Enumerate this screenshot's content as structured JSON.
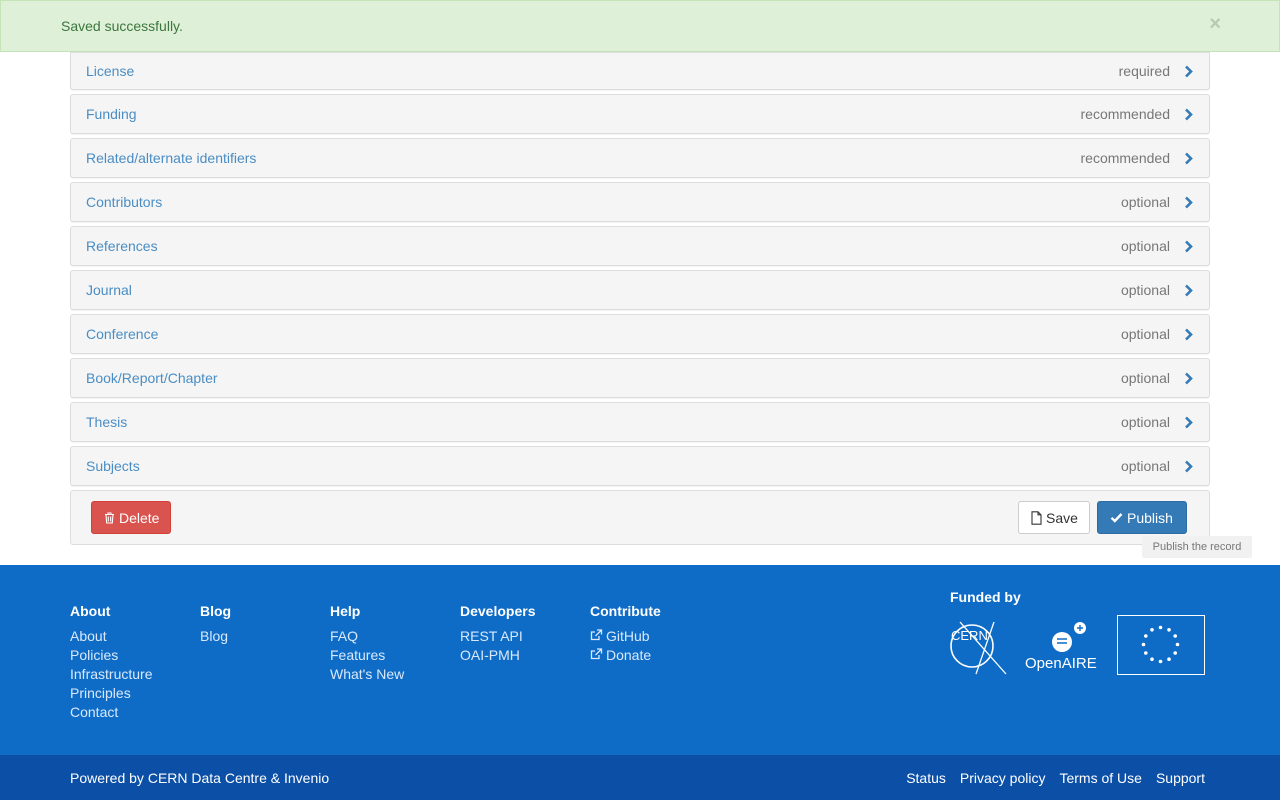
{
  "alert": {
    "message": "Saved successfully.",
    "close": "×"
  },
  "panels": [
    {
      "title": "License",
      "status": "required"
    },
    {
      "title": "Funding",
      "status": "recommended"
    },
    {
      "title": "Related/alternate identifiers",
      "status": "recommended"
    },
    {
      "title": "Contributors",
      "status": "optional"
    },
    {
      "title": "References",
      "status": "optional"
    },
    {
      "title": "Journal",
      "status": "optional"
    },
    {
      "title": "Conference",
      "status": "optional"
    },
    {
      "title": "Book/Report/Chapter",
      "status": "optional"
    },
    {
      "title": "Thesis",
      "status": "optional"
    },
    {
      "title": "Subjects",
      "status": "optional"
    }
  ],
  "actions": {
    "delete": "Delete",
    "save": "Save",
    "publish": "Publish",
    "publish_tooltip": "Publish the record"
  },
  "footer": {
    "columns": [
      {
        "heading": "About",
        "links": [
          "About",
          "Policies",
          "Infrastructure",
          "Principles",
          "Contact"
        ]
      },
      {
        "heading": "Blog",
        "links": [
          "Blog"
        ]
      },
      {
        "heading": "Help",
        "links": [
          "FAQ",
          "Features",
          "What's New"
        ]
      },
      {
        "heading": "Developers",
        "links": [
          "REST API",
          "OAI-PMH"
        ]
      },
      {
        "heading": "Contribute",
        "links": [
          "GitHub",
          "Donate"
        ]
      }
    ],
    "funded_by": "Funded by",
    "logos": {
      "cern": "CERN",
      "openaire": "OpenAIRE"
    }
  },
  "bottom": {
    "powered_prefix": "Powered by ",
    "powered_link": "CERN Data Centre & Invenio",
    "links": [
      "Status",
      "Privacy policy",
      "Terms of Use",
      "Support"
    ]
  },
  "colors": {
    "link": "#4a8dc4",
    "footer_bg": "#0e6cc7",
    "bottom_bg": "#0b4fa6",
    "danger": "#d9534f",
    "primary": "#337ab7",
    "success_bg": "#dff0d8"
  },
  "icons": {
    "delete": "trash-icon",
    "save": "file-icon",
    "publish": "check-icon",
    "panel": "chevron-right-icon",
    "external": "external-link-icon"
  }
}
